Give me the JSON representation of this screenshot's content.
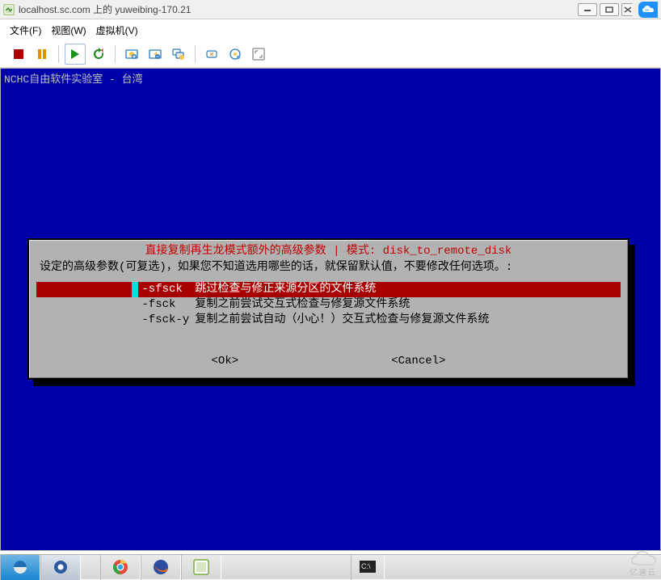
{
  "titlebar": {
    "title": "localhost.sc.com 上的 yuweibing-170.21"
  },
  "menubar": {
    "file": "文件(F)",
    "view": "视图(W)",
    "vm": "虚拟机(V)"
  },
  "console": {
    "header": "NCHC自由软件实验室 - 台湾"
  },
  "dialog": {
    "title": "直接复制再生龙模式额外的高级参数 | 模式: disk_to_remote_disk",
    "message": "设定的高级参数(可复选)，如果您不知道选用哪些的话，就保留默认值，不要修改任何选项。:",
    "options": [
      {
        "flag": "-sfsck",
        "desc": "跳过检查与修正来源分区的文件系统",
        "selected": true
      },
      {
        "flag": "-fsck",
        "desc": "复制之前尝试交互式检查与修复源文件系统",
        "selected": false
      },
      {
        "flag": "-fsck-y",
        "desc": "复制之前尝试自动（小心！）交互式检查与修复源文件系统",
        "selected": false
      }
    ],
    "ok": "<Ok>",
    "cancel": "<Cancel>"
  },
  "tray": {
    "brand": "亿速云"
  }
}
